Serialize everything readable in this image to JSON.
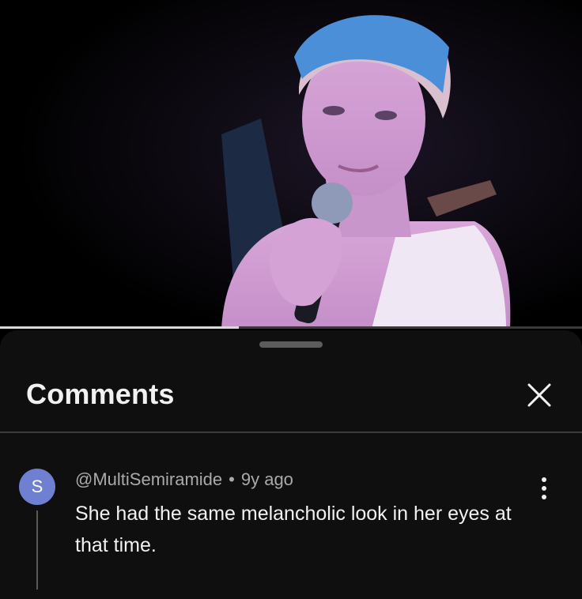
{
  "player": {
    "progress_fraction": 0.41
  },
  "comments_panel": {
    "title": "Comments",
    "close_icon": "close-icon",
    "comments": [
      {
        "avatar_letter": "S",
        "avatar_color": "#6f7fd1",
        "author": "@MultiSemiramide",
        "separator": "•",
        "time": "9y ago",
        "text": "She had the same melancholic look in her eyes at that time.",
        "menu_icon": "more-vertical-icon"
      }
    ]
  },
  "colors": {
    "sheet_background": "#0f0f0f",
    "text_primary": "#f1f1f1",
    "text_secondary": "#aaaaaa"
  }
}
